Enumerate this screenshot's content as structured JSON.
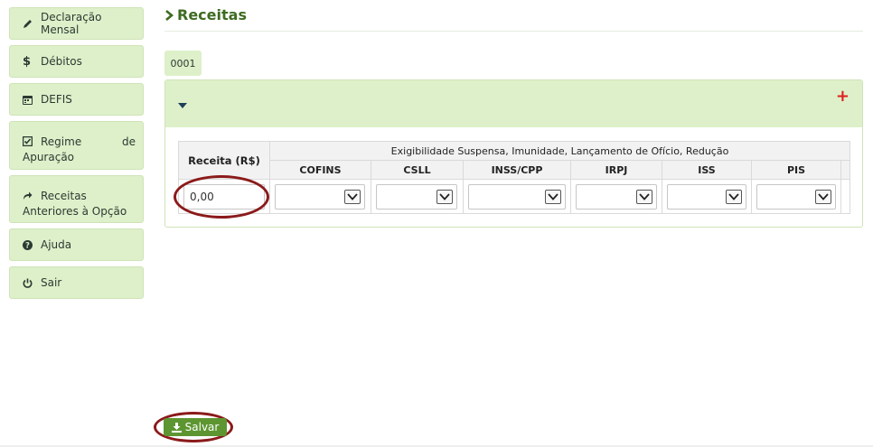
{
  "sidebar": {
    "items": [
      {
        "icon": "pencil-icon",
        "label": "Declaração Mensal"
      },
      {
        "icon": "dollar-icon",
        "label": "Débitos"
      },
      {
        "icon": "calendar-icon",
        "label": "DEFIS"
      },
      {
        "icon": "check-square-icon",
        "label_a": "Regime",
        "label_b": "de",
        "label_c": "Apuração"
      },
      {
        "icon": "share-arrow-icon",
        "label_a": "Receitas",
        "label_b": "Anteriores à Opção"
      },
      {
        "icon": "question-circle-icon",
        "label": "Ajuda"
      },
      {
        "icon": "power-icon",
        "label": "Sair"
      }
    ]
  },
  "page": {
    "title": "Receitas"
  },
  "tabs": [
    {
      "label": "0001"
    }
  ],
  "panel": {
    "add_symbol": "+",
    "table": {
      "receita_header": "Receita (R$)",
      "group_header": "Exigibilidade Suspensa, Imunidade, Lançamento de Ofício, Redução",
      "columns": [
        "COFINS",
        "CSLL",
        "INSS/CPP",
        "IRPJ",
        "ISS",
        "PIS"
      ],
      "receita_value": "0,00"
    }
  },
  "actions": {
    "save_label": "Salvar"
  },
  "colors": {
    "accent_green": "#5d9631",
    "title_green": "#3e6b22",
    "panel_bg": "#ddf0c9",
    "highlight_red": "#8b1a1a",
    "plus_red": "#e01e1e"
  }
}
